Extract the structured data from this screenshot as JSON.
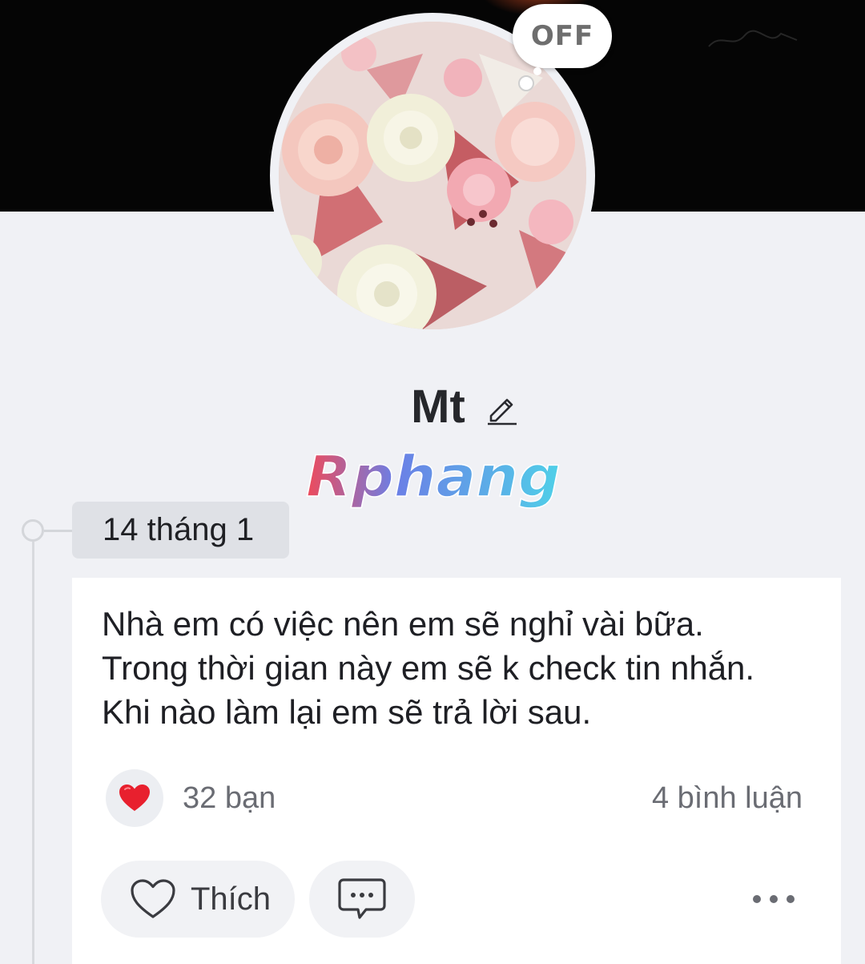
{
  "profile": {
    "status_label": "OFF",
    "name": "Mt",
    "watermark_text": "Rphang"
  },
  "timeline": {
    "date_label": "14 tháng 1"
  },
  "post": {
    "lines": [
      "Nhà em có việc nên em sẽ nghỉ vài bữa.",
      "Trong thời gian này em sẽ k check tin nhắn.",
      "Khi nào làm lại em sẽ trả lời sau."
    ],
    "reaction_count_label": "32 bạn",
    "comment_count_label": "4 bình luận",
    "like_label": "Thích"
  },
  "icons": {
    "edit": "pencil-icon",
    "reaction": "heart-icon",
    "like": "heart-outline-icon",
    "comment": "comment-bubble-icon",
    "more": "more-dots-icon"
  },
  "colors": {
    "reaction_heart": "#e8202e",
    "page_background": "#f0f1f5",
    "card_background": "#ffffff"
  }
}
